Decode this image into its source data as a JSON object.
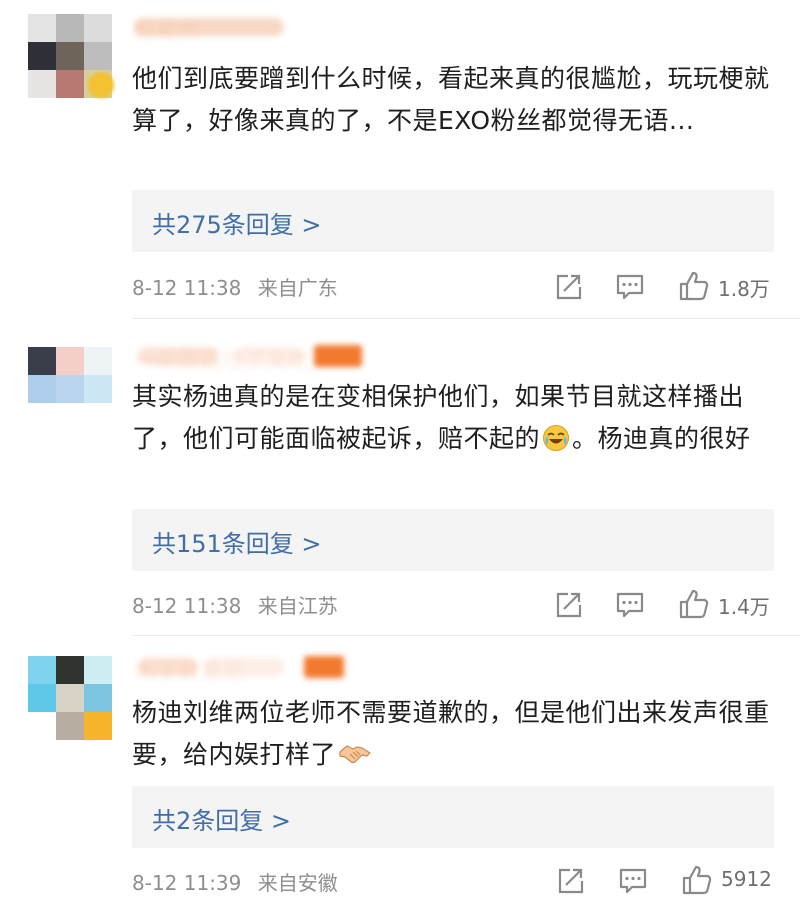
{
  "comments": [
    {
      "username": "陈昊然 ",
      "content": "他们到底要蹭到什么时候，看起来真的很尴尬，玩玩梗就算了，好像来真的了，不是EXO粉丝都觉得无语...",
      "reply": "共275条回复 >",
      "time": "8-12 11:38",
      "location": "来自广东",
      "likes": "1.8万"
    },
    {
      "username": "一朵蘑菇吃了又吃",
      "content_before": "其实杨迪真的是在变相保护他们，如果节目就这样播出了，他们可能面临被起诉，赔不起的",
      "content_after": "。杨迪真的很好",
      "reply": "共151条回复 >",
      "time": "8-12 11:38",
      "location": "来自江苏",
      "likes": "1.4万"
    },
    {
      "username": "木子有意见",
      "content": "杨迪刘维两位老师不需要道歉的，但是他们出来发声很重要，给内娱打样了",
      "reply": "共2条回复 >",
      "time": "8-12 11:39",
      "location": "来自安徽",
      "likes": "5912"
    }
  ],
  "icons": {
    "share": "share-icon",
    "comment": "comment-icon",
    "like": "like-icon",
    "emoji_laugh": "laughing-crying-emoji-icon",
    "emoji_handshake": "handshake-emoji-icon"
  },
  "colors": {
    "reply_link": "#3f6ea8",
    "meta_text": "#8e8e8e",
    "reply_bg": "#f4f4f4"
  }
}
